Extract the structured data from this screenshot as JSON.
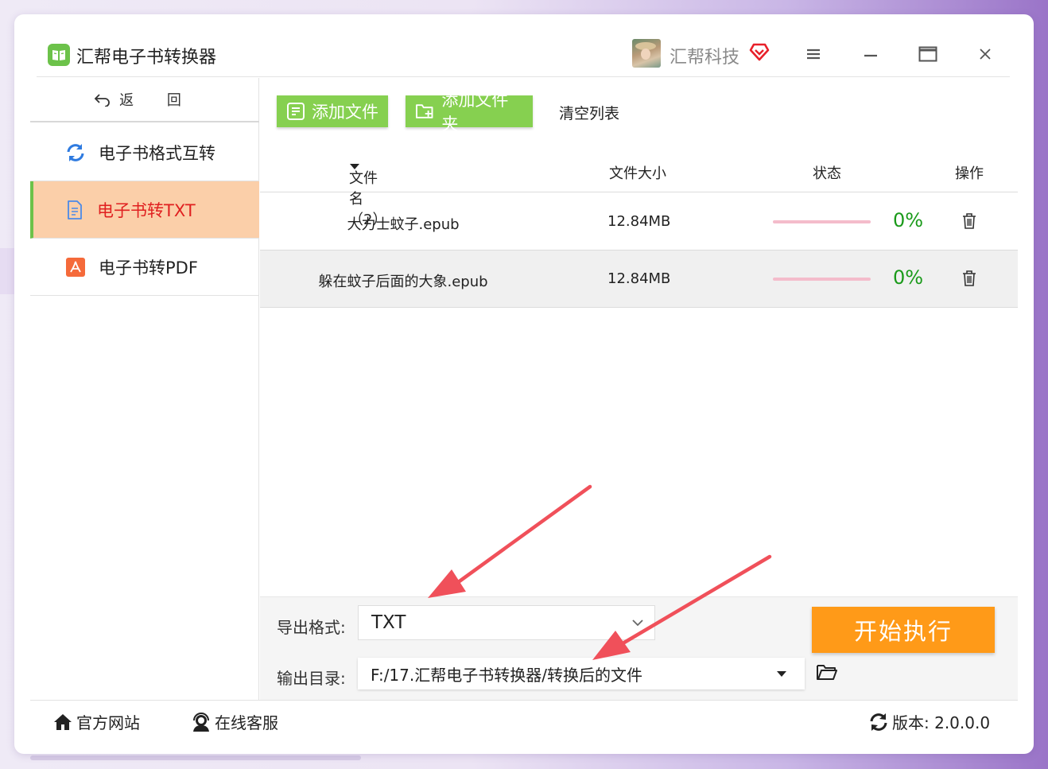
{
  "app": {
    "title": "汇帮电子书转换器",
    "company": "汇帮科技"
  },
  "sidebar": {
    "back_label": "返 回",
    "items": [
      {
        "label": "电子书格式互转",
        "icon": "refresh-icon"
      },
      {
        "label": "电子书转TXT",
        "icon": "document-icon",
        "active": true
      },
      {
        "label": "电子书转PDF",
        "icon": "pdf-icon"
      }
    ]
  },
  "toolbar": {
    "add_file": "添加文件",
    "add_folder": "添加文件夹",
    "clear_list": "清空列表"
  },
  "table": {
    "columns": {
      "name": "文件名（2）",
      "size": "文件大小",
      "status": "状态",
      "action": "操作"
    },
    "rows": [
      {
        "name": "大力士蚊子.epub",
        "size": "12.84MB",
        "progress": "0%"
      },
      {
        "name": "躲在蚊子后面的大象.epub",
        "size": "12.84MB",
        "progress": "0%"
      }
    ]
  },
  "export": {
    "format_label": "导出格式:",
    "format_value": "TXT",
    "dir_label": "输出目录:",
    "dir_value": "F:/17.汇帮电子书转换器/转换后的文件",
    "start_label": "开始执行"
  },
  "footer": {
    "website": "官方网站",
    "support": "在线客服",
    "version": "版本: 2.0.0.0"
  },
  "colors": {
    "accent_green": "#86d050",
    "active_bg": "#fbcfa9",
    "active_text": "#e02020",
    "start_orange": "#ff9a18",
    "arrow_red": "#f0505a"
  }
}
